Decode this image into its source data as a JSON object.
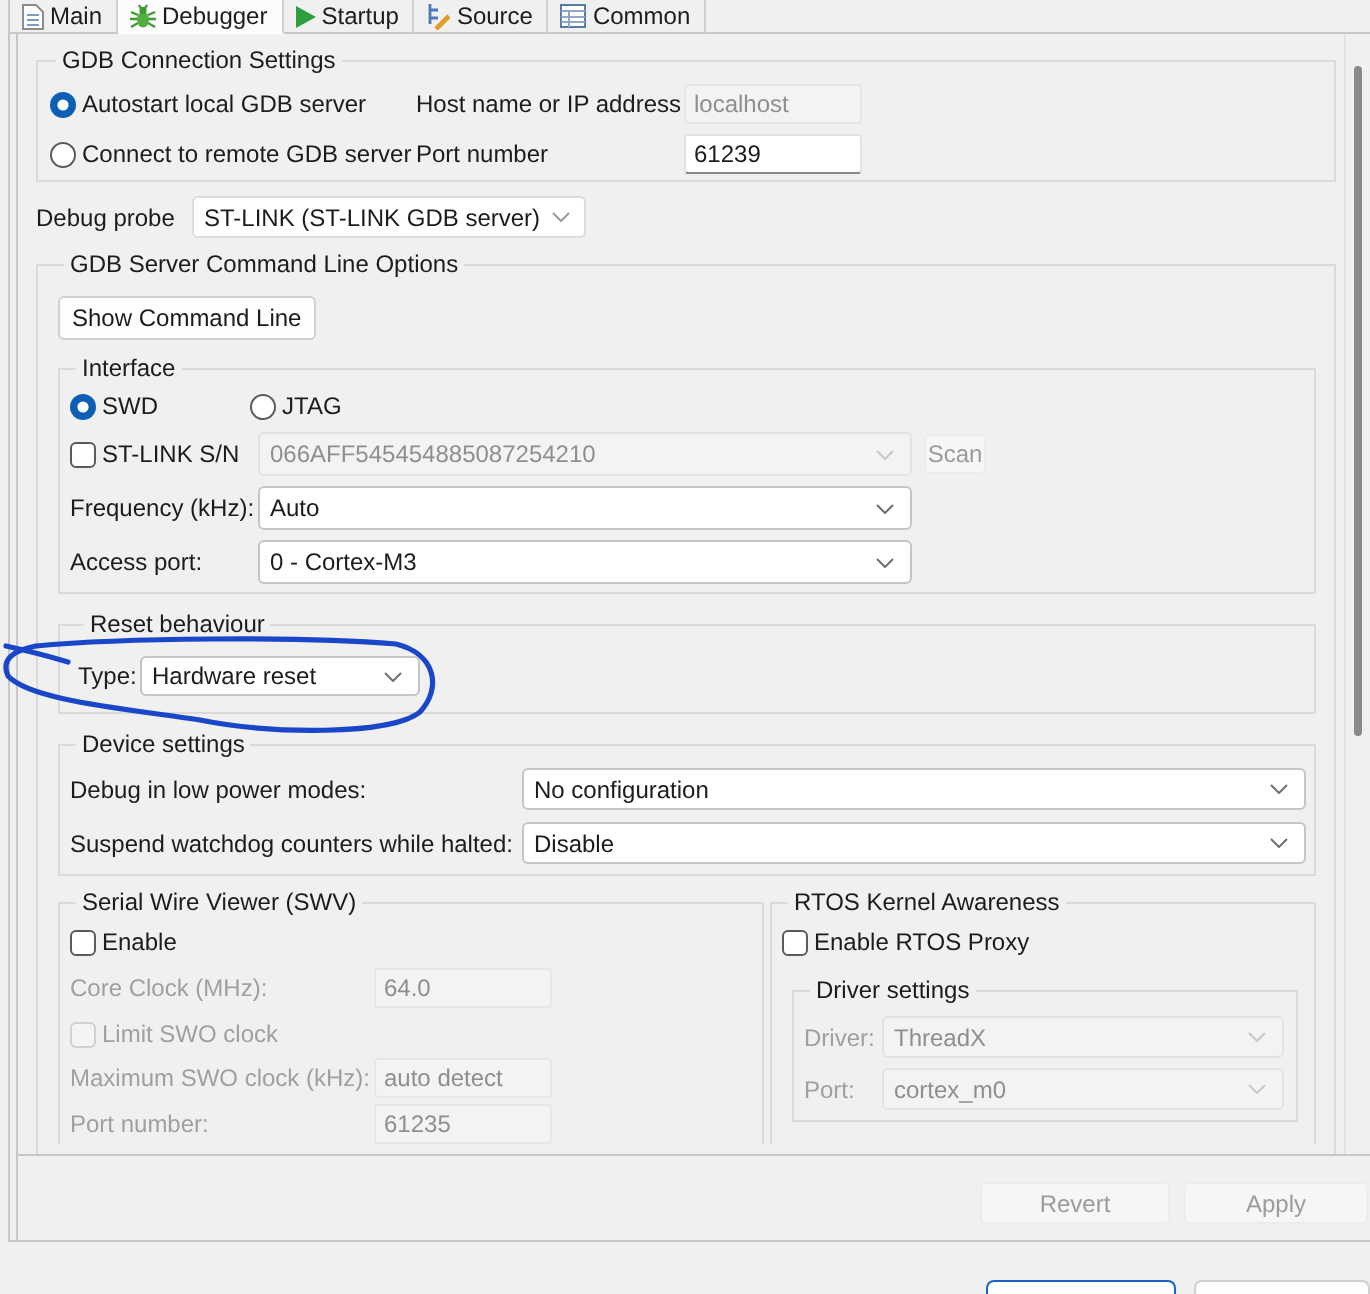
{
  "tabs": [
    {
      "label": "Main",
      "selected": false
    },
    {
      "label": "Debugger",
      "selected": true
    },
    {
      "label": "Startup",
      "selected": false
    },
    {
      "label": "Source",
      "selected": false
    },
    {
      "label": "Common",
      "selected": false
    }
  ],
  "gdb_connection": {
    "title": "GDB Connection Settings",
    "modes": [
      {
        "label": "Autostart local GDB server",
        "selected": true
      },
      {
        "label": "Connect to remote GDB server",
        "selected": false
      }
    ],
    "host": {
      "label": "Host name or IP address",
      "value": "localhost",
      "disabled": true
    },
    "port": {
      "label": "Port number",
      "value": "61239",
      "disabled": false
    }
  },
  "debug_probe": {
    "label": "Debug probe",
    "value": "ST-LINK (ST-LINK GDB server)"
  },
  "server_options": {
    "title": "GDB Server Command Line Options",
    "button": "Show Command Line",
    "interface": {
      "title": "Interface",
      "protocols": [
        {
          "label": "SWD",
          "selected": true
        },
        {
          "label": "JTAG",
          "selected": false
        }
      ],
      "serial": {
        "label": "ST-LINK S/N",
        "checked": false,
        "value": "066AFF545454885087254210",
        "disabled": true,
        "scan_button": {
          "label": "Scan",
          "disabled": true
        }
      },
      "frequency": {
        "label": "Frequency (kHz):",
        "value": "Auto"
      },
      "access_port": {
        "label": "Access port:",
        "value": "0 - Cortex-M3"
      }
    },
    "reset": {
      "title": "Reset behaviour",
      "label": "Type:",
      "value": "Hardware reset"
    },
    "device": {
      "title": "Device settings",
      "rows": [
        {
          "label": "Debug in low power modes:",
          "value": "No configuration"
        },
        {
          "label": "Suspend watchdog counters while halted:",
          "value": "Disable"
        }
      ]
    },
    "swv": {
      "title": "Serial Wire Viewer (SWV)",
      "enable": {
        "label": "Enable",
        "checked": false
      },
      "rows": [
        {
          "kind": "field",
          "label": "Core Clock (MHz):",
          "value": "64.0",
          "disabled": true
        },
        {
          "kind": "checkbox",
          "label": "Limit SWO clock",
          "checked": false,
          "disabled": true
        },
        {
          "kind": "field",
          "label": "Maximum SWO clock (kHz):",
          "value": "auto detect",
          "disabled": true
        },
        {
          "kind": "field",
          "label": "Port number:",
          "value": "61235",
          "disabled": true
        }
      ]
    },
    "rtos": {
      "title": "RTOS Kernel Awareness",
      "enable": {
        "label": "Enable RTOS Proxy",
        "checked": false
      },
      "driver_settings": {
        "title": "Driver settings",
        "rows": [
          {
            "label": "Driver:",
            "value": "ThreadX",
            "disabled": true
          },
          {
            "label": "Port:",
            "value": "cortex_m0",
            "disabled": true
          }
        ]
      }
    }
  },
  "actions": [
    {
      "label": "Revert",
      "disabled": true
    },
    {
      "label": "Apply",
      "disabled": true
    }
  ],
  "dialog_buttons": [
    {
      "default": true
    },
    {
      "default": false
    }
  ]
}
